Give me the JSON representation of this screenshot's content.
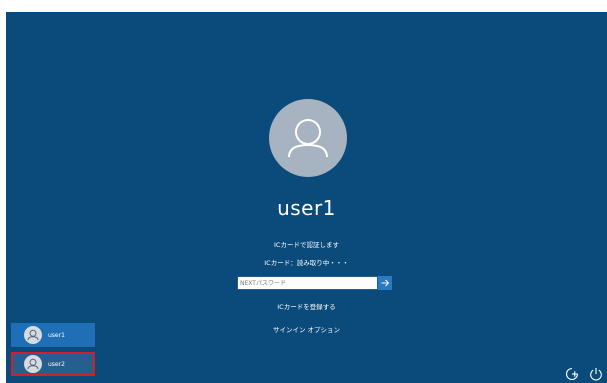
{
  "login": {
    "username": "user1",
    "status_line1": "ICカードで認証します",
    "status_line2": "ICカード：読み取り中・・・",
    "pin_placeholder": "NEXTパスワード",
    "register_card_link": "ICカードを登録する",
    "signin_options_link": "サインイン オプション"
  },
  "user_switcher": {
    "users": [
      {
        "label": "user1",
        "selected": true
      },
      {
        "label": "user2",
        "selected": false
      }
    ]
  },
  "icons": {
    "avatar": "person-icon",
    "submit": "arrow-right-icon",
    "accessibility": "ease-of-access-icon",
    "power": "power-icon"
  },
  "colors": {
    "background": "#0b4b7c",
    "avatar_bg": "#a7b3c0",
    "selected_user": "#1e6fb5",
    "highlight_border": "#d41f27",
    "submit_button": "#2a7ac0"
  }
}
